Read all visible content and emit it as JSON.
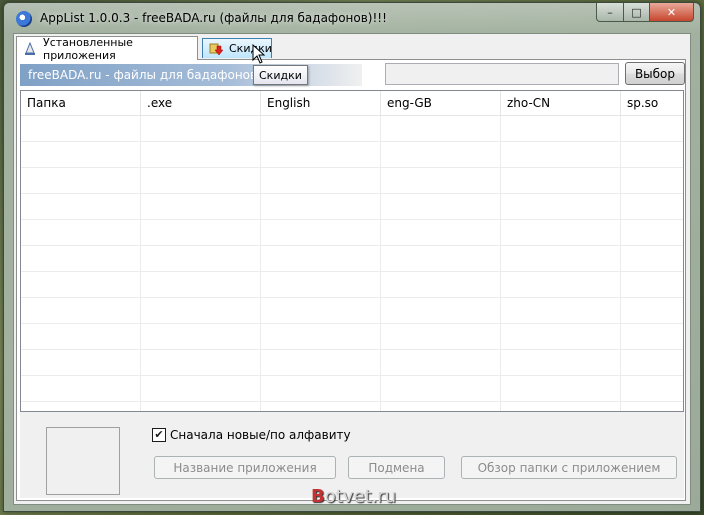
{
  "window": {
    "title": "AppList 1.0.0.3 - freeBADA.ru (файлы для бадафонов)!!!",
    "icon": "app-icon"
  },
  "tabs": [
    {
      "label": "Установленные приложения",
      "icon": "bell-icon",
      "active": true
    },
    {
      "label": "Скидки",
      "icon": "download-arrow-icon",
      "active": false
    }
  ],
  "tooltip": "Скидки",
  "banner": "freeBADA.ru - файлы для бадафонов!!!",
  "browse_button": "Выбор",
  "table": {
    "columns": [
      "Папка",
      ".exe",
      "English",
      "eng-GB",
      "zho-CN",
      "sp.so"
    ]
  },
  "sort_checkbox": {
    "label": "Сначала новые/по алфавиту",
    "checked": true
  },
  "buttons": {
    "app_name": "Название приложения",
    "substitute": "Подмена",
    "browse_app_folder": "Обзор папки с приложением"
  },
  "watermark": {
    "prefix": "B",
    "rest": "otvet.ru"
  },
  "colors": {
    "banner": "#7fa1c6",
    "close": "#c7462e",
    "hover_tab": "#bee6fd"
  }
}
